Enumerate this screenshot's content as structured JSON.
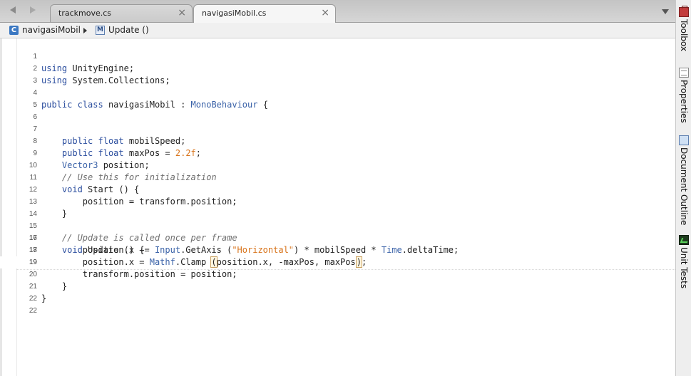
{
  "tabs": [
    {
      "label": "trackmove.cs",
      "active": false
    },
    {
      "label": "navigasiMobil.cs",
      "active": true
    }
  ],
  "breadcrumb": {
    "class_name": "navigasiMobil",
    "method_name": "Update ()"
  },
  "editor": {
    "current_line": 18,
    "lines": [
      {
        "n": "1"
      },
      {
        "n": "2"
      },
      {
        "n": "3"
      },
      {
        "n": "4"
      },
      {
        "n": "5"
      },
      {
        "n": "6"
      },
      {
        "n": "7"
      },
      {
        "n": "8"
      },
      {
        "n": "9"
      },
      {
        "n": "10"
      },
      {
        "n": "11"
      },
      {
        "n": "12"
      },
      {
        "n": "13"
      },
      {
        "n": "14"
      },
      {
        "n": "15"
      },
      {
        "n": "16"
      },
      {
        "n": "17"
      },
      {
        "n": "18"
      },
      {
        "n": "19"
      },
      {
        "n": "20"
      },
      {
        "n": "21"
      },
      {
        "n": "22"
      }
    ],
    "tokens": {
      "using": "using",
      "unity_engine": " UnityEngine;",
      "system_collections": " System.Collections;",
      "public": "public",
      "class": "class",
      "float": "float",
      "void": "void",
      "class_decl_name": " navigasiMobil : ",
      "mono_behaviour": "MonoBehaviour",
      "open_brace": " {",
      "mobil_speed_decl": " mobilSpeed;",
      "max_pos_decl": " maxPos = ",
      "max_pos_value": "2.2f",
      "semicolon": ";",
      "vector3": "Vector3",
      "position_decl": " position;",
      "comment_init": "// Use this for initialization",
      "start_sig": " Start () {",
      "assign_from_transform": "position = transform.position;",
      "close_brace": "}",
      "comment_update": "// Update is called once per frame",
      "update_sig": " Update () {",
      "l17_a": "position.x += ",
      "input": "Input",
      "l17_b": ".GetAxis (",
      "horizontal_str": "\"Horizontal\"",
      "l17_c": ") * mobilSpeed * ",
      "time": "Time",
      "l17_d": ".deltaTime;",
      "l18_a": "position.x = ",
      "mathf": "Mathf",
      "l18_b": ".Clamp ",
      "open_paren": "(",
      "l18_c": "position.x, -maxPos, maxPos",
      "close_paren": ")",
      "assign_to_transform": "transform.position = position;"
    }
  },
  "sidebar": {
    "toolbox": "Toolbox",
    "properties": "Properties",
    "document_outline": "Document Outline",
    "unit_tests": "Unit Tests"
  },
  "icons": {
    "back": "arrow-left-icon",
    "forward": "arrow-right-icon",
    "close": "close-icon",
    "overflow": "chevron-down-icon",
    "class": "class-icon",
    "method": "method-icon"
  },
  "colors": {
    "keyword": "#2a4d9e",
    "comment": "#6f6f6f",
    "string": "#d8731a"
  }
}
